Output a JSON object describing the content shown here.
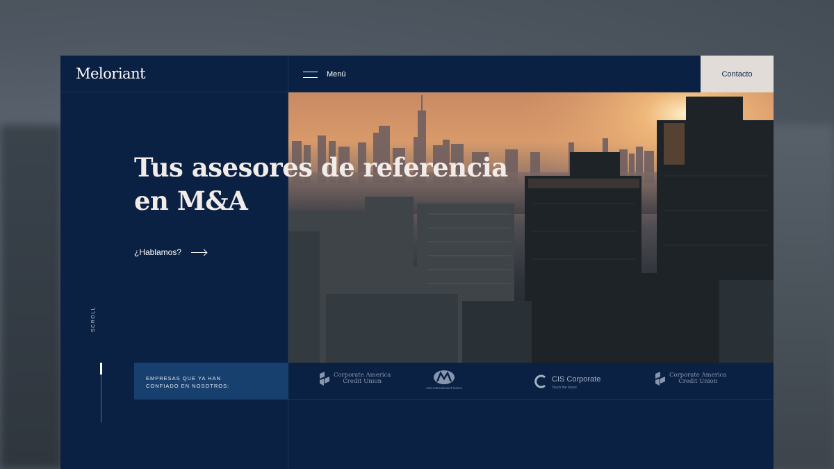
{
  "brand": {
    "name": "Meloriant"
  },
  "nav": {
    "menu_label": "Menú",
    "contact_label": "Contacto"
  },
  "hero": {
    "headline_line1": "Tus asesores de referencia",
    "headline_line2": "en M&A",
    "cta_label": "¿Hablamos?"
  },
  "scroll": {
    "label": "SCROLL",
    "progress": 0.2
  },
  "clients": {
    "label_line1": "EMPRESAS QUE YA HAN",
    "label_line2": "CONFIADO EN NOSOTROS:",
    "logos": [
      {
        "line1": "Corporate America",
        "line2": "Credit Union",
        "icon": "credit-union-icon"
      },
      {
        "line1": "Asia International Finance",
        "icon": "am-monogram-icon"
      },
      {
        "line1": "CIS Corporate",
        "line2": "Touch the future",
        "icon": "cis-c-icon"
      },
      {
        "line1": "Corporate America",
        "line2": "Credit Union",
        "icon": "credit-union-icon"
      }
    ]
  },
  "colors": {
    "navy": "#0b2143",
    "band_blue": "#17406f",
    "contact_bg": "#e2dcd8",
    "headline": "#f1ece8"
  }
}
